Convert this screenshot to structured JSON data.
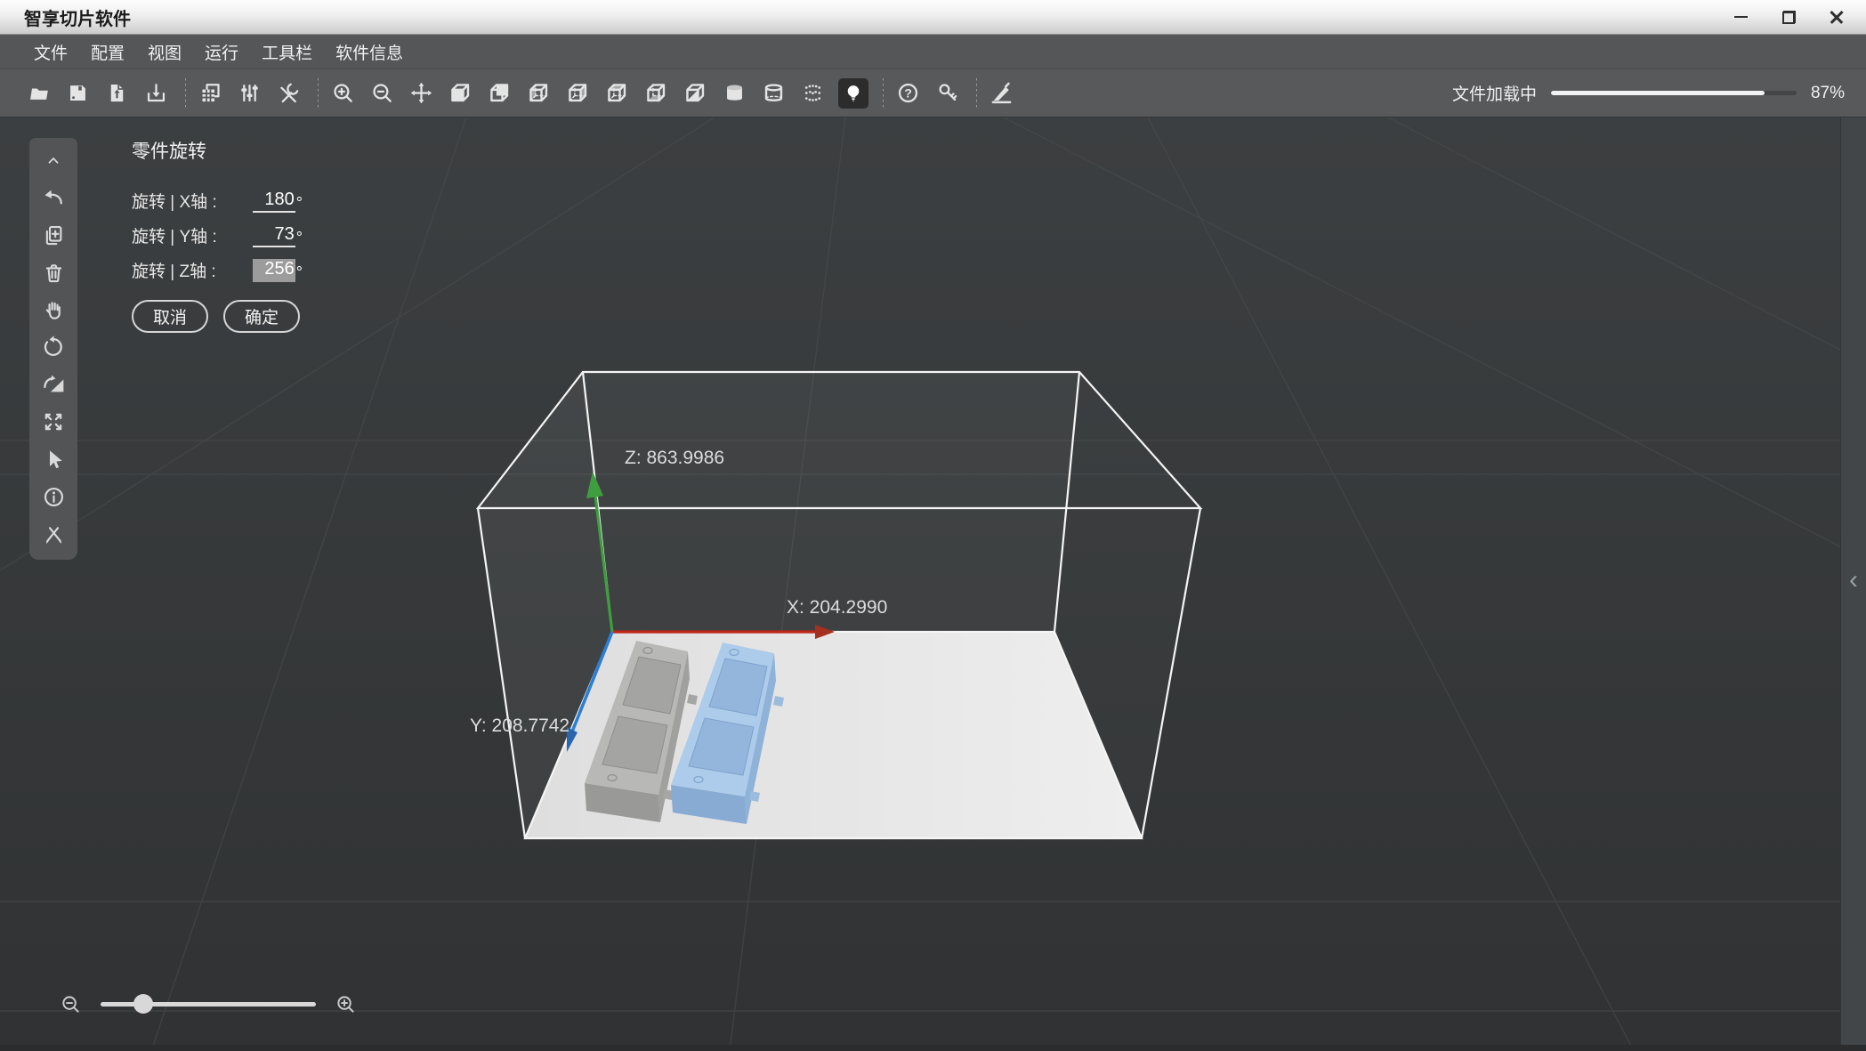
{
  "window": {
    "title": "智享切片软件",
    "controls": [
      "minimize",
      "restore",
      "close"
    ]
  },
  "menu": {
    "items": [
      "文件",
      "配置",
      "视图",
      "运行",
      "工具栏",
      "软件信息"
    ]
  },
  "toolbar": {
    "icons": [
      "open-file",
      "save",
      "import-model",
      "export-model",
      "copy-plate",
      "adjust-params",
      "tools",
      "zoom-in",
      "zoom-out",
      "move",
      "view-front",
      "view-back",
      "view-left",
      "view-right",
      "view-top",
      "view-bottom",
      "view-iso",
      "cylinder-solid",
      "cylinder-wireframe",
      "point-cloud",
      "light-toggle",
      "help",
      "license-key",
      "slice-knife"
    ],
    "active_icon": "light-toggle",
    "progress": {
      "label": "文件加载中",
      "value": "87%",
      "percent": 87,
      "fill_style": "width:87%"
    }
  },
  "sidebar": {
    "icons": [
      "collapse-up",
      "undo",
      "add-part",
      "delete-part",
      "pan-hand",
      "rotate-part",
      "mirror-part",
      "fit-view",
      "select-cursor",
      "part-info",
      "repair-part"
    ]
  },
  "rotation_panel": {
    "title": "零件旋转",
    "rows": [
      {
        "label": "旋转 | X轴 :",
        "value": "180",
        "unit": "°"
      },
      {
        "label": "旋转 | Y轴 :",
        "value": "73",
        "unit": "°"
      },
      {
        "label": "旋转 | Z轴 :",
        "value": "256",
        "unit": "°",
        "selected": true
      }
    ],
    "cancel_label": "取消",
    "confirm_label": "确定"
  },
  "viewport": {
    "axis_labels": {
      "x": "X: 204.2990",
      "y": "Y: 208.7742",
      "z": "Z: 863.9986"
    },
    "colors": {
      "background": "#3a3d3f",
      "axis_x": "#c0251a",
      "axis_y": "#2a7fd2",
      "axis_z": "#3f9e3f",
      "build_plate": "#e6e6e6",
      "wireframe": "#f5f5f5",
      "model_left": "#b8b8b6",
      "model_right": "#adcbea"
    },
    "models": [
      {
        "name": "tray-model-gray",
        "color": "#b8b8b6"
      },
      {
        "name": "tray-model-blue",
        "color": "#adcbea"
      }
    ],
    "panel_toggle_icon": "‹"
  },
  "zoom_control": {
    "icons": [
      "zoom-out",
      "zoom-in"
    ],
    "handle_style": "left:20%"
  }
}
